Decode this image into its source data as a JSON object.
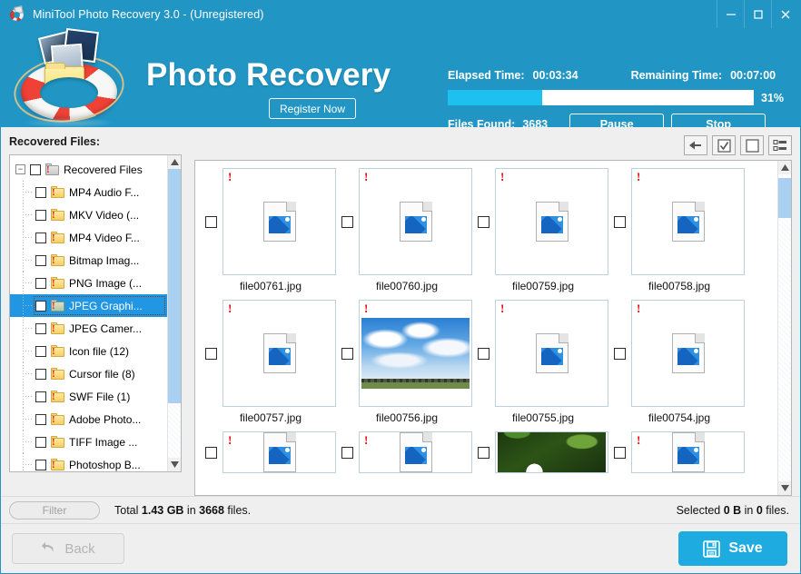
{
  "window": {
    "title": "MiniTool Photo Recovery 3.0 - (Unregistered)",
    "minimize_label": "—",
    "maximize_label": "□",
    "close_label": "✕",
    "accent_color": "#2196c4",
    "progress_fill_color": "#1ec0ef",
    "save_color": "#1eabe0"
  },
  "banner": {
    "product_title": "Photo Recovery",
    "register_label": "Register Now",
    "elapsed_label": "Elapsed Time:",
    "elapsed_value": "00:03:34",
    "remaining_label": "Remaining Time:",
    "remaining_value": "00:07:00",
    "progress_percent_label": "31%",
    "progress_percent": 31,
    "files_found_label": "Files Found:",
    "files_found_value": "3683",
    "pause_label": "Pause",
    "stop_label": "Stop"
  },
  "left_pane": {
    "title": "Recovered Files:",
    "root": {
      "label": "Recovered Files",
      "expander": "−"
    },
    "items": [
      {
        "label": "MP4 Audio F..."
      },
      {
        "label": "MKV Video (..."
      },
      {
        "label": "MP4 Video F..."
      },
      {
        "label": "Bitmap Imag..."
      },
      {
        "label": "PNG Image (..."
      },
      {
        "label": "JPEG Graphi...",
        "selected": true
      },
      {
        "label": "JPEG Camer..."
      },
      {
        "label": "Icon file (12)"
      },
      {
        "label": "Cursor file (8)"
      },
      {
        "label": "SWF File (1)"
      },
      {
        "label": "Adobe Photo..."
      },
      {
        "label": "TIFF Image ..."
      },
      {
        "label": "Photoshop B..."
      }
    ]
  },
  "toolbar": {
    "back_icon": "arrow-left-icon",
    "select_all_icon": "checked-box-icon",
    "deselect_all_icon": "empty-box-icon",
    "list_view_icon": "list-view-icon"
  },
  "grid": {
    "rows": [
      [
        {
          "name": "file00761.jpg",
          "thumb": "doc"
        },
        {
          "name": "file00760.jpg",
          "thumb": "doc"
        },
        {
          "name": "file00759.jpg",
          "thumb": "doc"
        },
        {
          "name": "file00758.jpg",
          "thumb": "doc"
        }
      ],
      [
        {
          "name": "file00757.jpg",
          "thumb": "doc"
        },
        {
          "name": "file00756.jpg",
          "thumb": "sky"
        },
        {
          "name": "file00755.jpg",
          "thumb": "doc"
        },
        {
          "name": "file00754.jpg",
          "thumb": "doc"
        }
      ],
      [
        {
          "name": "",
          "thumb": "doc"
        },
        {
          "name": "",
          "thumb": "doc"
        },
        {
          "name": "",
          "thumb": "flower"
        },
        {
          "name": "",
          "thumb": "doc"
        }
      ]
    ],
    "warning_glyph": "!"
  },
  "statusbar": {
    "filter_label": "Filter",
    "total_prefix": "Total ",
    "total_size": "1.43 GB",
    "total_middle": " in ",
    "total_count": "3668",
    "total_suffix": " files.",
    "selected_prefix": "Selected ",
    "selected_size": "0 B",
    "selected_middle": " in ",
    "selected_count": "0",
    "selected_suffix": " files."
  },
  "footer": {
    "back_label": "Back",
    "save_label": "Save"
  }
}
